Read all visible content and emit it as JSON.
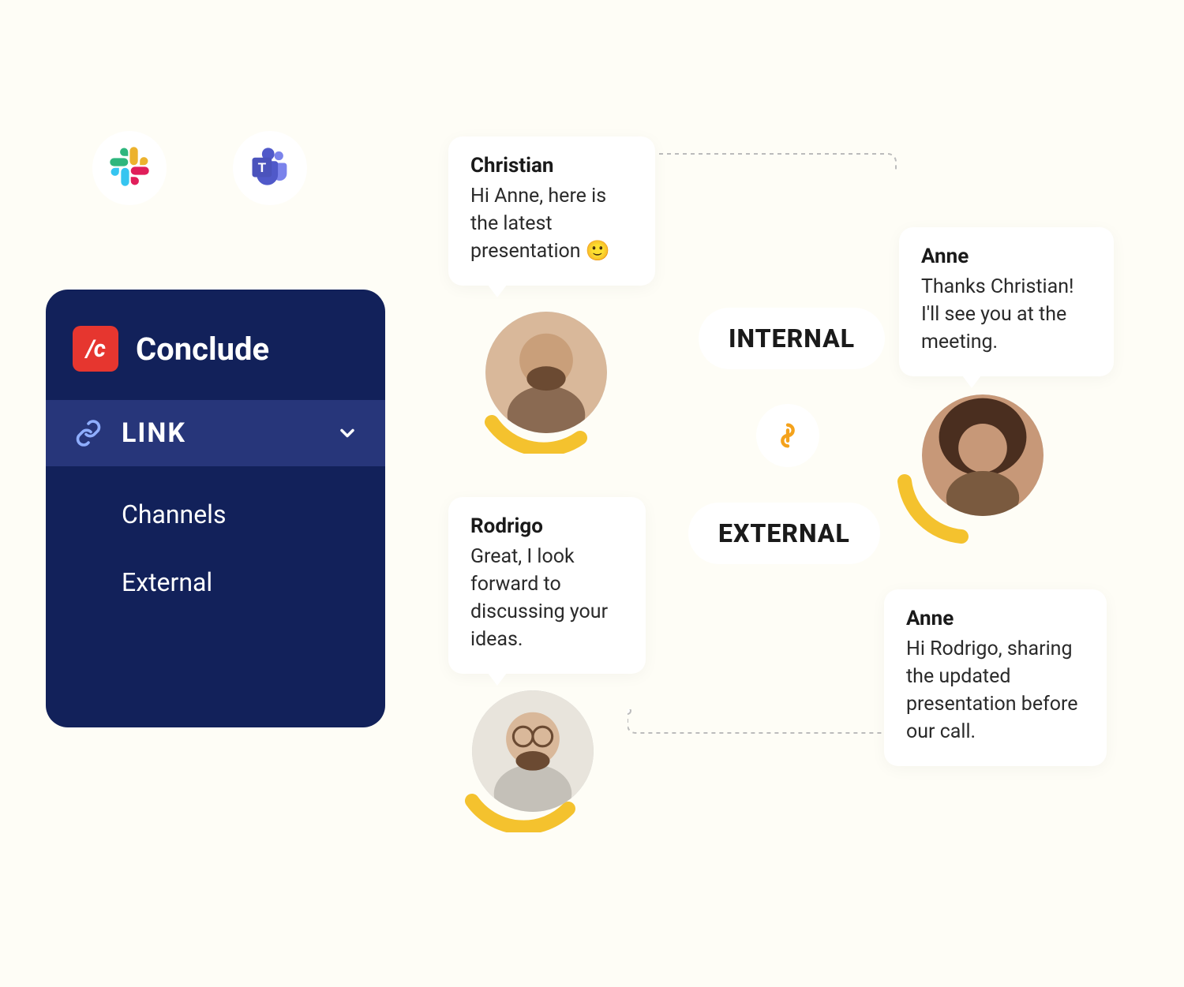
{
  "icons": {
    "slack": "slack-icon",
    "teams": "teams-icon"
  },
  "sidebar": {
    "app_title": "Conclude",
    "logo_text": "/c",
    "link_label": "LINK",
    "items": [
      {
        "label": "Channels"
      },
      {
        "label": "External"
      }
    ]
  },
  "tags": {
    "internal": "INTERNAL",
    "external": "EXTERNAL"
  },
  "messages": {
    "christian": {
      "name": "Christian",
      "text": "Hi Anne, here is the latest presentation 🙂"
    },
    "anne1": {
      "name": "Anne",
      "text": "Thanks Christian! I'll see you at the meeting."
    },
    "rodrigo": {
      "name": "Rodrigo",
      "text": "Great, I look forward to discussing your ideas."
    },
    "anne2": {
      "name": "Anne",
      "text": "Hi Rodrigo, sharing the updated presentation before our call."
    }
  }
}
